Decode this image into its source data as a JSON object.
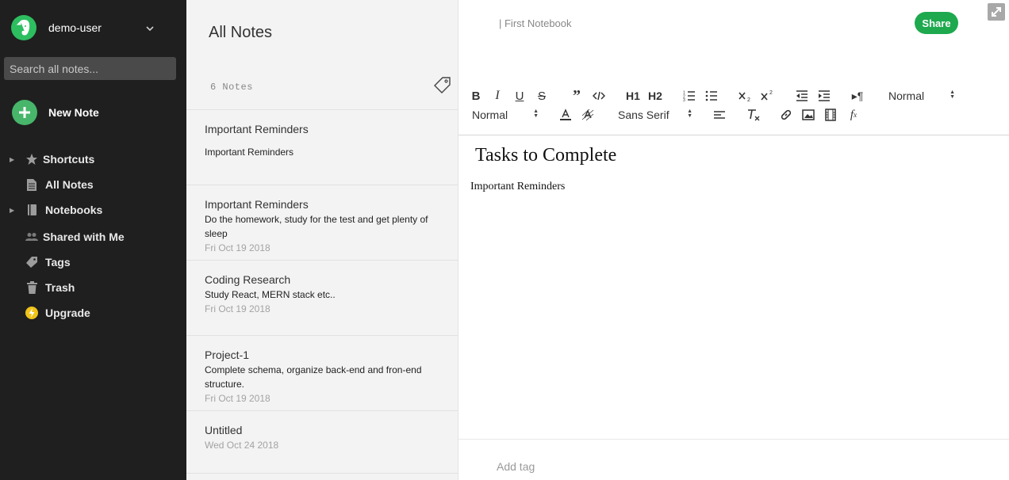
{
  "sidebar": {
    "user_name": "demo-user",
    "search_placeholder": "Search all notes...",
    "new_note_label": "New Note",
    "items": [
      {
        "label": "Shortcuts",
        "icon": "star-icon"
      },
      {
        "label": "All Notes",
        "icon": "notes-icon"
      },
      {
        "label": "Notebooks",
        "icon": "notebook-icon"
      },
      {
        "label": "Shared with Me",
        "icon": "people-icon"
      },
      {
        "label": "Tags",
        "icon": "tag-icon"
      },
      {
        "label": "Trash",
        "icon": "trash-icon"
      },
      {
        "label": "Upgrade",
        "icon": "lightning-icon"
      }
    ],
    "colors": {
      "background": "#1f1f1f",
      "brand_green": "#2dbe60",
      "upgrade_yellow": "#f0c419"
    }
  },
  "notelist": {
    "title": "All Notes",
    "count_label": "6 Notes",
    "notes": [
      {
        "title": "Important Reminders",
        "snippet": "Important Reminders",
        "date": ""
      },
      {
        "title": "Important Reminders",
        "snippet": "Do the homework, study for the test and get plenty of sleep",
        "date": "Fri Oct 19 2018"
      },
      {
        "title": "Coding Research",
        "snippet": "Study React, MERN stack etc..",
        "date": "Fri Oct 19 2018"
      },
      {
        "title": "Project-1",
        "snippet": "Complete schema, organize back-end and fron-end structure.",
        "date": "Fri Oct 19 2018"
      },
      {
        "title": "Untitled",
        "snippet": "",
        "date": "Wed Oct 24 2018"
      }
    ]
  },
  "editor": {
    "notebook_label": "| First Notebook",
    "share_label": "Share",
    "toolbar": {
      "header_select": "Normal",
      "size_select": "Normal",
      "font_select": "Sans Serif",
      "h1": "H1",
      "h2": "H2"
    },
    "doc_title": "Tasks to Complete",
    "doc_body": "Important Reminders",
    "add_tag_placeholder": "Add tag",
    "colors": {
      "share_green": "#1ea94f"
    }
  }
}
